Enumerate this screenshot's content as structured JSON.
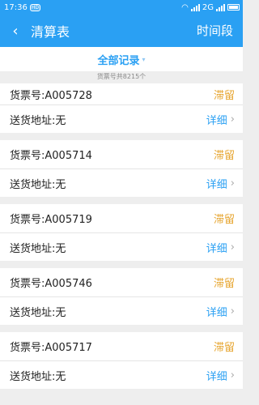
{
  "status_bar": {
    "time": "17:36",
    "hd": "HD",
    "network": "2G"
  },
  "header": {
    "back_icon": "back-arrow-icon",
    "title": "清算表",
    "time_filter": "时间段"
  },
  "filter": {
    "label": "全部记录",
    "arrow": "▾"
  },
  "summary": {
    "text": "货票号共8215个"
  },
  "records": [
    {
      "ticket_label": "货票号:",
      "ticket": "A005728",
      "status": "滞留",
      "address_label": "送货地址:",
      "address": "无",
      "detail": "详细"
    },
    {
      "ticket_label": "货票号:",
      "ticket": "A005714",
      "status": "滞留",
      "address_label": "送货地址:",
      "address": "无",
      "detail": "详细"
    },
    {
      "ticket_label": "货票号:",
      "ticket": "A005719",
      "status": "滞留",
      "address_label": "送货地址:",
      "address": "无",
      "detail": "详细"
    },
    {
      "ticket_label": "货票号:",
      "ticket": "A005746",
      "status": "滞留",
      "address_label": "送货地址:",
      "address": "无",
      "detail": "详细"
    },
    {
      "ticket_label": "货票号:",
      "ticket": "A005717",
      "status": "滞留",
      "address_label": "送货地址:",
      "address": "无",
      "detail": "详细"
    }
  ]
}
